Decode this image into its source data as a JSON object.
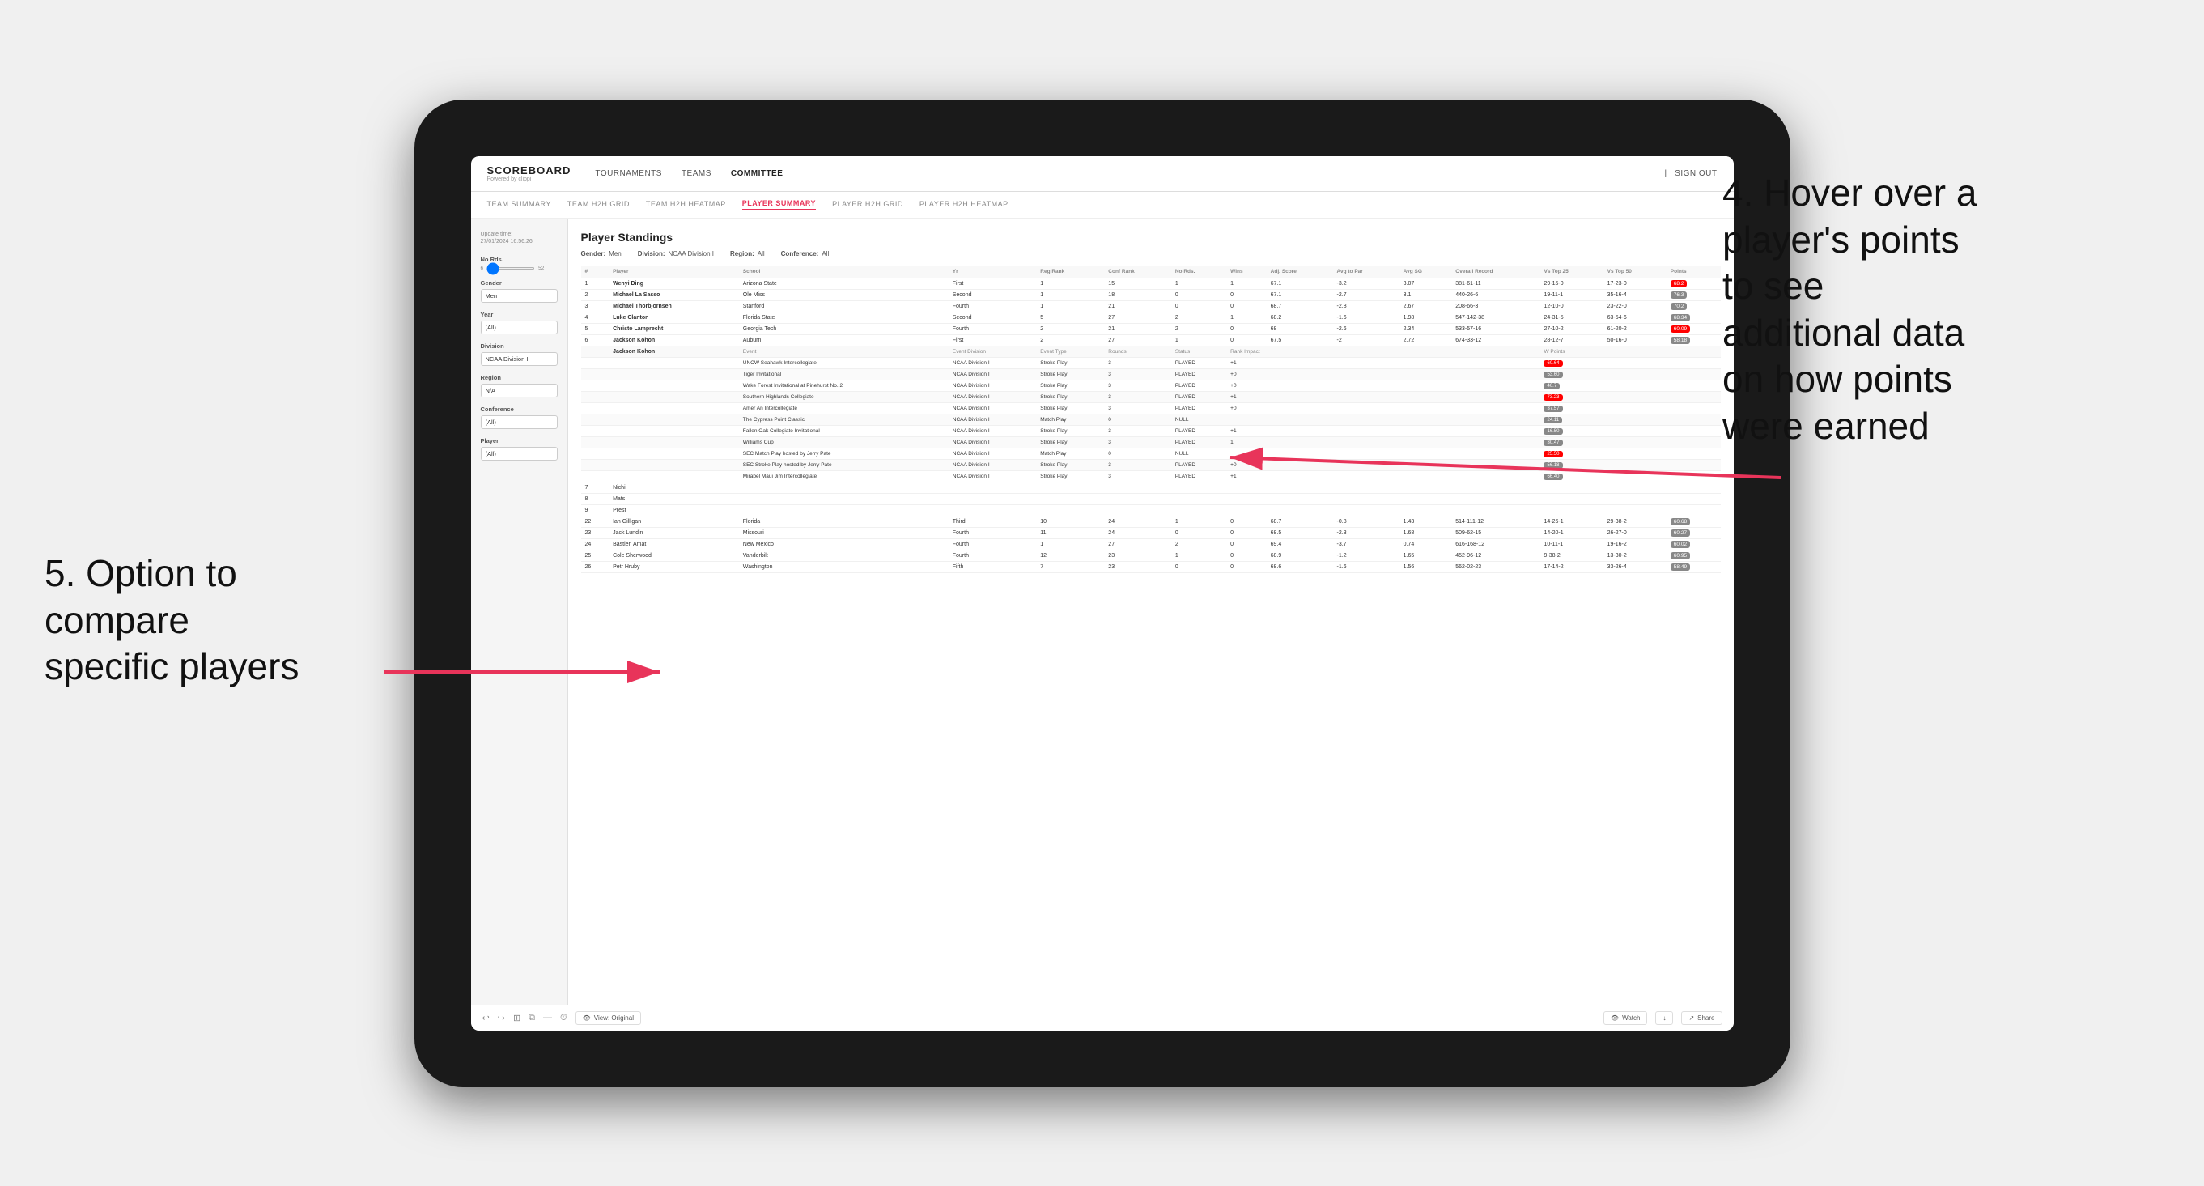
{
  "app": {
    "logo": "SCOREBOARD",
    "logo_sub": "Powered by clippi",
    "nav": [
      "TOURNAMENTS",
      "TEAMS",
      "COMMITTEE"
    ],
    "sign_out": "Sign out",
    "sub_nav": [
      "TEAM SUMMARY",
      "TEAM H2H GRID",
      "TEAM H2H HEATMAP",
      "PLAYER SUMMARY",
      "PLAYER H2H GRID",
      "PLAYER H2H HEATMAP"
    ]
  },
  "sidebar": {
    "update_label": "Update time:",
    "update_time": "27/01/2024 16:56:26",
    "no_rds_label": "No Rds.",
    "no_rds_min": "6",
    "no_rds_max": "52",
    "gender_label": "Gender",
    "gender_value": "Men",
    "year_label": "Year",
    "year_value": "(All)",
    "division_label": "Division",
    "division_value": "NCAA Division I",
    "region_label": "Region",
    "region_value": "N/A",
    "conference_label": "Conference",
    "conference_value": "(All)",
    "player_label": "Player",
    "player_value": "(All)"
  },
  "player_standings": {
    "title": "Player Standings",
    "gender": "Men",
    "division": "NCAA Division I",
    "region": "All",
    "conference": "All",
    "columns": [
      "#",
      "Player",
      "School",
      "Yr",
      "Reg Rank",
      "Conf Rank",
      "No Rds.",
      "Wins",
      "Adj. Score",
      "Avg to Par",
      "Avg SG",
      "Overall Record",
      "Vs Top 25",
      "Vs Top 50",
      "Points"
    ],
    "rows": [
      {
        "num": 1,
        "player": "Wenyi Ding",
        "school": "Arizona State",
        "yr": "First",
        "reg_rank": 1,
        "conf_rank": 15,
        "no_rds": 1,
        "wins": 1,
        "adj_score": 67.1,
        "to_par": -3.2,
        "avg_sg": 3.07,
        "record": "381-61-11",
        "vs25": "29-15-0",
        "vs50": "17-23-0",
        "points": "68.2",
        "points_color": "red"
      },
      {
        "num": 2,
        "player": "Michael La Sasso",
        "school": "Ole Miss",
        "yr": "Second",
        "reg_rank": 1,
        "conf_rank": 18,
        "no_rds": 0,
        "wins": 0,
        "adj_score": 67.1,
        "to_par": -2.7,
        "avg_sg": 3.1,
        "record": "440-26-6",
        "vs25": "19-11-1",
        "vs50": "35-16-4",
        "points": "76.3",
        "points_color": "gray"
      },
      {
        "num": 3,
        "player": "Michael Thorbjornsen",
        "school": "Stanford",
        "yr": "Fourth",
        "reg_rank": 1,
        "conf_rank": 21,
        "no_rds": 0,
        "wins": 0,
        "adj_score": 68.7,
        "to_par": -2.8,
        "avg_sg": 2.67,
        "record": "208-66-3",
        "vs25": "12-10-0",
        "vs50": "23-22-0",
        "points": "70.2",
        "points_color": "gray"
      },
      {
        "num": 4,
        "player": "Luke Clanton",
        "school": "Florida State",
        "yr": "Second",
        "reg_rank": 5,
        "conf_rank": 27,
        "no_rds": 2,
        "wins": 1,
        "adj_score": 68.2,
        "to_par": -1.6,
        "avg_sg": 1.98,
        "record": "547-142-38",
        "vs25": "24-31-5",
        "vs50": "63-54-6",
        "points": "68.34",
        "points_color": "gray"
      },
      {
        "num": 5,
        "player": "Christo Lamprecht",
        "school": "Georgia Tech",
        "yr": "Fourth",
        "reg_rank": 2,
        "conf_rank": 21,
        "no_rds": 2,
        "wins": 0,
        "adj_score": 68.0,
        "to_par": -2.6,
        "avg_sg": 2.34,
        "record": "533-57-16",
        "vs25": "27-10-2",
        "vs50": "61-20-2",
        "points": "60.09",
        "points_color": "red"
      },
      {
        "num": 6,
        "player": "Jackson Kohon",
        "school": "Auburn",
        "yr": "First",
        "reg_rank": 2,
        "conf_rank": 27,
        "no_rds": 1,
        "wins": 0,
        "adj_score": 67.5,
        "to_par": -2.0,
        "avg_sg": 2.72,
        "record": "674-33-12",
        "vs25": "28-12-7",
        "vs50": "50-16-0",
        "points": "58.18",
        "points_color": "gray"
      },
      {
        "num": 7,
        "player": "Nichi",
        "school": "",
        "yr": "",
        "reg_rank": null,
        "conf_rank": null,
        "no_rds": null,
        "wins": null,
        "adj_score": null,
        "to_par": null,
        "avg_sg": null,
        "record": "",
        "vs25": "",
        "vs50": "",
        "points": "",
        "points_color": "none"
      },
      {
        "num": 8,
        "player": "Mats",
        "school": "",
        "yr": "",
        "reg_rank": null,
        "conf_rank": null,
        "no_rds": null,
        "wins": null,
        "adj_score": null,
        "to_par": null,
        "avg_sg": null,
        "record": "",
        "vs25": "",
        "vs50": "",
        "points": "",
        "points_color": "none"
      },
      {
        "num": 9,
        "player": "Prest",
        "school": "",
        "yr": "",
        "reg_rank": null,
        "conf_rank": null,
        "no_rds": null,
        "wins": null,
        "adj_score": null,
        "to_par": null,
        "avg_sg": null,
        "record": "",
        "vs25": "",
        "vs50": "",
        "points": "",
        "points_color": "none"
      }
    ],
    "tooltip_player": "Jackson Kohon",
    "tooltip_rows": [
      {
        "event": "UNCW Seahawk Intercollegiate",
        "division": "NCAA Division I",
        "type": "Stroke Play",
        "rounds": 3,
        "status": "PLAYED",
        "rank_impact": "+1",
        "w_points": "60.64",
        "w_color": "red"
      },
      {
        "event": "Tiger Invitational",
        "division": "NCAA Division I",
        "type": "Stroke Play",
        "rounds": 3,
        "status": "PLAYED",
        "rank_impact": "+0",
        "w_points": "53.60",
        "w_color": "gray"
      },
      {
        "event": "Wake Forest Invitational at Pinehurst No. 2",
        "division": "NCAA Division I",
        "type": "Stroke Play",
        "rounds": 3,
        "status": "PLAYED",
        "rank_impact": "+0",
        "w_points": "40.7",
        "w_color": "gray"
      },
      {
        "event": "Southern Highlands Collegiate",
        "division": "NCAA Division I",
        "type": "Stroke Play",
        "rounds": 3,
        "status": "PLAYED",
        "rank_impact": "+1",
        "w_points": "73.23",
        "w_color": "red"
      },
      {
        "event": "Amer An Intercollegiate",
        "division": "NCAA Division I",
        "type": "Stroke Play",
        "rounds": 3,
        "status": "PLAYED",
        "rank_impact": "+0",
        "w_points": "37.57",
        "w_color": "gray"
      },
      {
        "event": "The Cypress Point Classic",
        "division": "NCAA Division I",
        "type": "Match Play",
        "rounds": 0,
        "status": "NULL",
        "rank_impact": "",
        "w_points": "24.11",
        "w_color": "gray"
      },
      {
        "event": "Fallen Oak Collegiate Invitational",
        "division": "NCAA Division I",
        "type": "Stroke Play",
        "rounds": 3,
        "status": "PLAYED",
        "rank_impact": "+1",
        "w_points": "16.50",
        "w_color": "gray"
      },
      {
        "event": "Williams Cup",
        "division": "NCAA Division I",
        "type": "Stroke Play",
        "rounds": 3,
        "status": "PLAYED",
        "rank_impact": "1",
        "w_points": "30.47",
        "w_color": "gray"
      },
      {
        "event": "SEC Match Play hosted by Jerry Pate",
        "division": "NCAA Division I",
        "type": "Match Play",
        "rounds": 0,
        "status": "NULL",
        "rank_impact": "",
        "w_points": "25.50",
        "w_color": "red"
      },
      {
        "event": "SEC Stroke Play hosted by Jerry Pate",
        "division": "NCAA Division I",
        "type": "Stroke Play",
        "rounds": 3,
        "status": "PLAYED",
        "rank_impact": "+0",
        "w_points": "56.18",
        "w_color": "gray"
      },
      {
        "event": "Mirabel Maui Jim Intercollegiate",
        "division": "NCAA Division I",
        "type": "Stroke Play",
        "rounds": 3,
        "status": "PLAYED",
        "rank_impact": "+1",
        "w_points": "66.40",
        "w_color": "gray"
      }
    ],
    "lower_rows": [
      {
        "num": 22,
        "player": "Ian Gilligan",
        "school": "Florida",
        "yr": "Third",
        "reg_rank": 10,
        "conf_rank": 24,
        "no_rds": 1,
        "wins": 0,
        "adj_score": 68.7,
        "to_par": -0.8,
        "avg_sg": 1.43,
        "record": "514-111-12",
        "vs25": "14-26-1",
        "vs50": "29-38-2",
        "points": "60.68",
        "points_color": "gray"
      },
      {
        "num": 23,
        "player": "Jack Lundin",
        "school": "Missouri",
        "yr": "Fourth",
        "reg_rank": 11,
        "conf_rank": 24,
        "no_rds": 0,
        "wins": 0,
        "adj_score": 68.5,
        "to_par": -2.3,
        "avg_sg": 1.68,
        "record": "509-62-15",
        "vs25": "14-20-1",
        "vs50": "26-27-0",
        "points": "60.27",
        "points_color": "gray"
      },
      {
        "num": 24,
        "player": "Bastien Amat",
        "school": "New Mexico",
        "yr": "Fourth",
        "reg_rank": 1,
        "conf_rank": 27,
        "no_rds": 2,
        "wins": 0,
        "adj_score": 69.4,
        "to_par": -3.7,
        "avg_sg": 0.74,
        "record": "616-168-12",
        "vs25": "10-11-1",
        "vs50": "19-16-2",
        "points": "60.02",
        "points_color": "gray"
      },
      {
        "num": 25,
        "player": "Cole Sherwood",
        "school": "Vanderbilt",
        "yr": "Fourth",
        "reg_rank": 12,
        "conf_rank": 23,
        "no_rds": 1,
        "wins": 0,
        "adj_score": 68.9,
        "to_par": -1.2,
        "avg_sg": 1.65,
        "record": "452-96-12",
        "vs25": "9-38-2",
        "vs50": "13-30-2",
        "points": "60.95",
        "points_color": "gray"
      },
      {
        "num": 26,
        "player": "Petr Hruby",
        "school": "Washington",
        "yr": "Fifth",
        "reg_rank": 7,
        "conf_rank": 23,
        "no_rds": 0,
        "wins": 0,
        "adj_score": 68.6,
        "to_par": -1.6,
        "avg_sg": 1.56,
        "record": "562-02-23",
        "vs25": "17-14-2",
        "vs50": "33-26-4",
        "points": "58.49",
        "points_color": "gray"
      }
    ]
  },
  "annotations": {
    "hover_title": "4. Hover over a\nplayer's points\nto see\nadditional data\non how points\nwere earned",
    "compare_title": "5. Option to\ncompare\nspecific players"
  },
  "bottom_bar": {
    "view_label": "View: Original",
    "watch_label": "Watch",
    "share_label": "Share"
  }
}
